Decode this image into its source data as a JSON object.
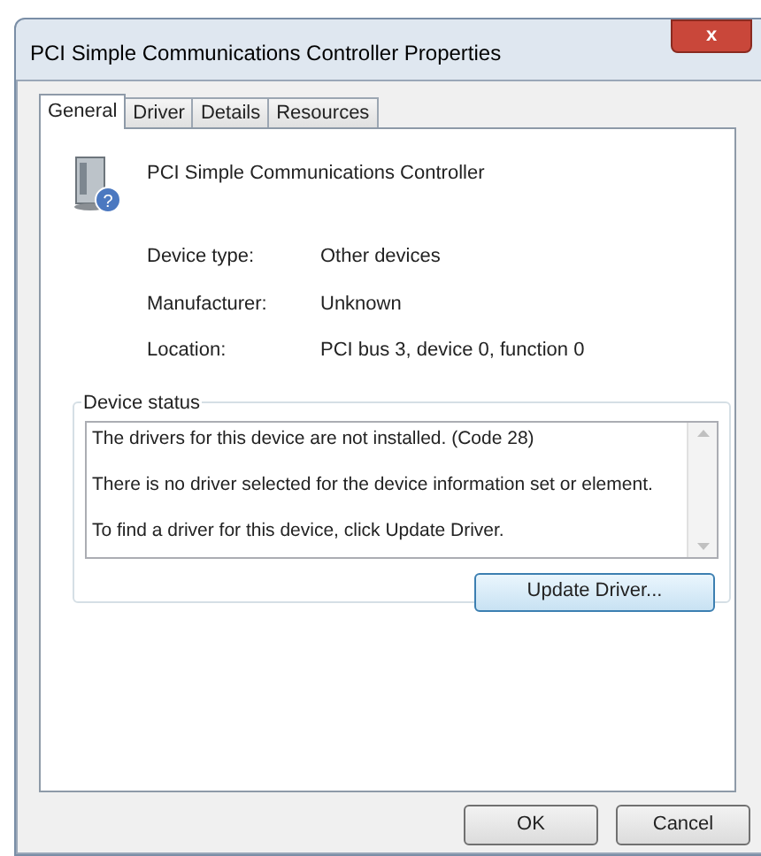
{
  "window": {
    "title": "PCI Simple Communications Controller Properties",
    "close": "x"
  },
  "tabs": [
    {
      "label": "General",
      "selected": true
    },
    {
      "label": "Driver",
      "selected": false
    },
    {
      "label": "Details",
      "selected": false
    },
    {
      "label": "Resources",
      "selected": false
    }
  ],
  "device": {
    "name": "PCI Simple Communications Controller",
    "badge": "?"
  },
  "properties": [
    {
      "label": "Device type:",
      "value": "Other devices"
    },
    {
      "label": "Manufacturer:",
      "value": "Unknown"
    },
    {
      "label": "Location:",
      "value": "PCI bus 3, device 0, function 0"
    }
  ],
  "device_status": {
    "title": "Device status",
    "paragraphs": [
      "The drivers for this device are not installed. (Code 28)",
      "There is no driver selected for the device information set or element.",
      "To find a driver for this device, click Update Driver."
    ],
    "button": "Update Driver..."
  },
  "buttons": [
    "OK",
    "Cancel"
  ]
}
